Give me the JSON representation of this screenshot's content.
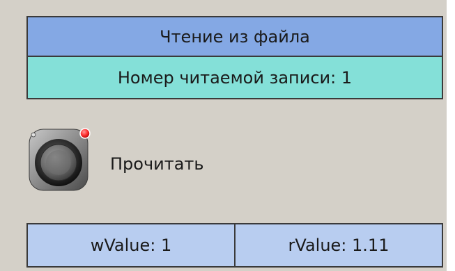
{
  "header": {
    "title": "Чтение из файла"
  },
  "record": {
    "text": "Номер читаемой записи: 1"
  },
  "read_button": {
    "label": "Прочитать",
    "icon": "push-button-icon"
  },
  "values": {
    "w": "wValue: 1",
    "r": "rValue: 1.11"
  },
  "colors": {
    "panel_bg": "#d4d0c8",
    "header_bg": "#84a8e4",
    "record_bg": "#84e0d8",
    "values_bg": "#b8cdf0",
    "indicator_red": "#ff4040"
  }
}
